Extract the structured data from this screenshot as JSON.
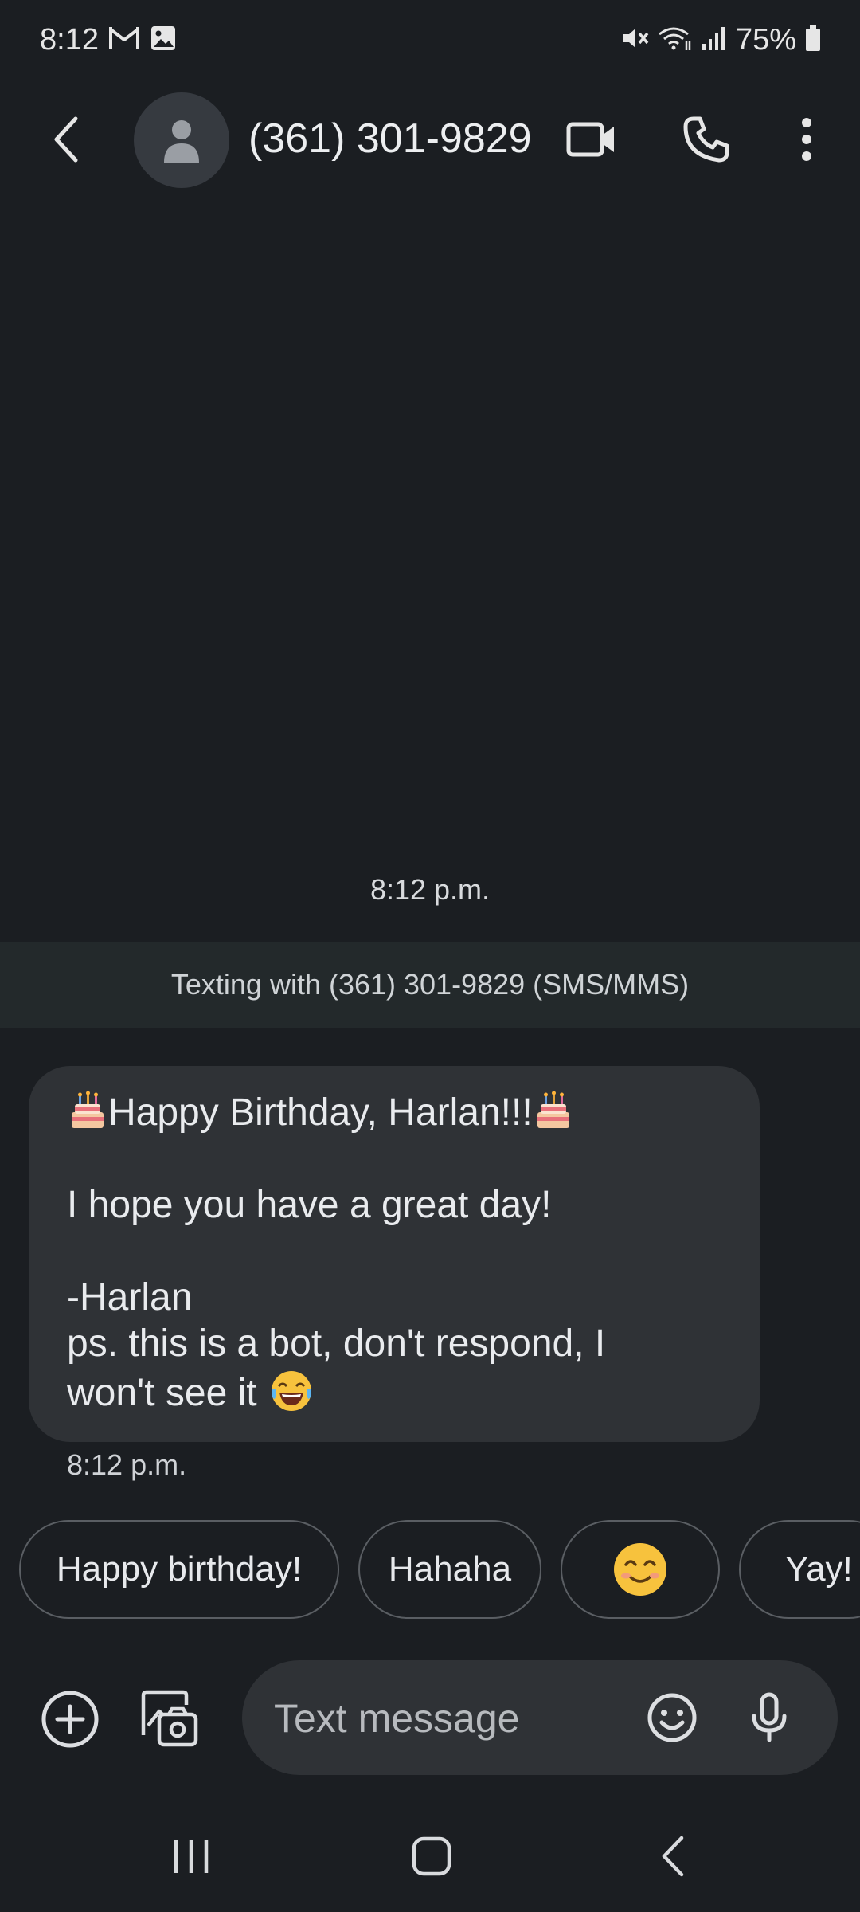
{
  "status_bar": {
    "time": "8:12",
    "battery": "75%",
    "icons": [
      "gmail-icon",
      "image-icon",
      "mute-icon",
      "wifi-icon",
      "signal-icon",
      "battery-icon"
    ]
  },
  "header": {
    "contact": "(361) 301-9829",
    "icons": [
      "back-icon",
      "avatar-icon",
      "video-call-icon",
      "phone-icon",
      "more-icon"
    ]
  },
  "conversation": {
    "top_timestamp": "8:12 p.m.",
    "banner": "Texting with (361) 301-9829 (SMS/MMS)",
    "message": {
      "line1": "Happy Birthday, Harlan!!!",
      "line2": "I hope you have a great day!",
      "line3": "-Harlan",
      "line4": "ps. this is a bot, don't respond, I",
      "line5": "won't see it",
      "time": "8:12 p.m."
    }
  },
  "smart_replies": [
    "Happy birthday!",
    "Hahaha",
    "😊",
    "Yay!"
  ],
  "compose": {
    "placeholder": "Text message",
    "icons": [
      "add-icon",
      "gallery-icon",
      "emoji-icon",
      "mic-icon"
    ]
  },
  "nav": {
    "icons": [
      "recents-icon",
      "home-icon",
      "back-nav-icon"
    ]
  },
  "colors": {
    "background": "#1b1e22",
    "bubble": "#2f3236",
    "banner": "#23292b",
    "text": "#e4e6ea"
  }
}
